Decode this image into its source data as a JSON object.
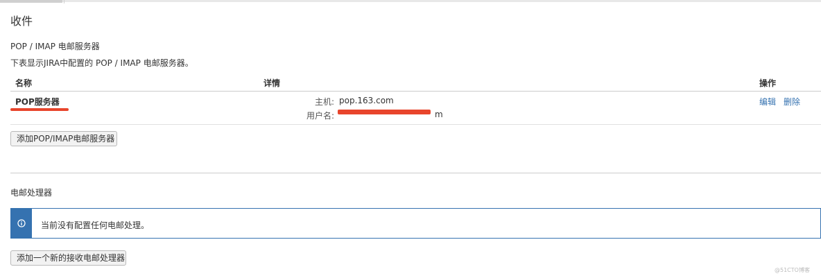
{
  "page": {
    "title": "收件"
  },
  "pop_imap": {
    "title": "POP / IMAP 电邮服务器",
    "description": "下表显示JIRA中配置的 POP / IMAP 电邮服务器。",
    "columns": {
      "name": "名称",
      "details": "详情",
      "operations": "操作"
    },
    "server": {
      "name": "POP服务器",
      "host_label": "主机:",
      "host_value": "pop.163.com",
      "user_label": "用户名:",
      "user_value_visible_suffix": "m",
      "edit_label": "编辑",
      "delete_label": "删除"
    },
    "add_button_label": "添加POP/IMAP电邮服务器"
  },
  "handlers": {
    "title": "电邮处理器",
    "info_message": "当前没有配置任何电邮处理。",
    "add_button_label": "添加一个新的接收电邮处理器"
  },
  "watermark": "@51CTO博客",
  "colors": {
    "link": "#3572b0",
    "info_accent": "#3572b0",
    "redaction": "#e8452c"
  },
  "icons": {
    "info": "info-circle-icon"
  }
}
